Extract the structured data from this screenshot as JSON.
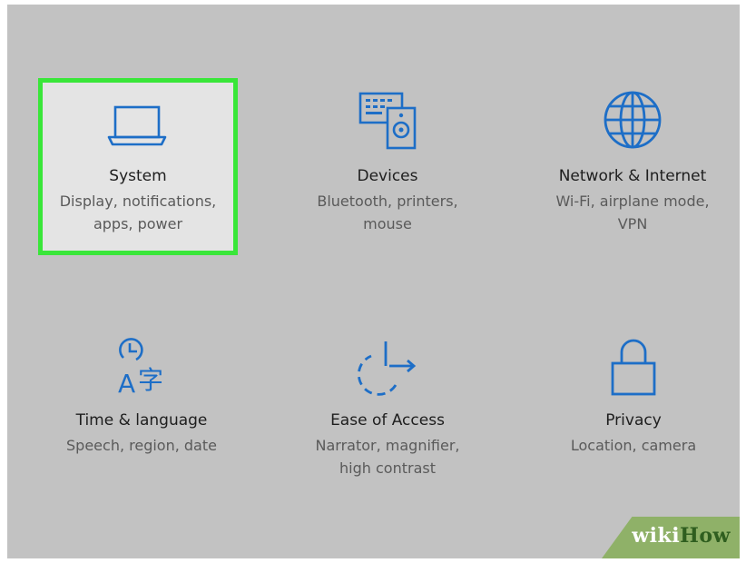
{
  "settings": {
    "accent_color": "#1d6ec7",
    "highlight_color": "#39e639",
    "tiles": [
      {
        "title": "System",
        "desc1": "Display, notifications,",
        "desc2": "apps, power",
        "icon": "laptop-icon",
        "selected": true
      },
      {
        "title": "Devices",
        "desc1": "Bluetooth, printers,",
        "desc2": "mouse",
        "icon": "devices-icon"
      },
      {
        "title": "Network & Internet",
        "desc1": "Wi-Fi, airplane mode,",
        "desc2": "VPN",
        "icon": "globe-icon"
      },
      {
        "title": "Time & language",
        "desc1": "Speech, region, date",
        "desc2": "",
        "icon": "time-language-icon"
      },
      {
        "title": "Ease of Access",
        "desc1": "Narrator, magnifier,",
        "desc2": "high contrast",
        "icon": "ease-of-access-icon"
      },
      {
        "title": "Privacy",
        "desc1": "Location, camera",
        "desc2": "",
        "icon": "lock-icon"
      }
    ]
  },
  "watermark": {
    "part1": "wiki",
    "part2": "How"
  }
}
